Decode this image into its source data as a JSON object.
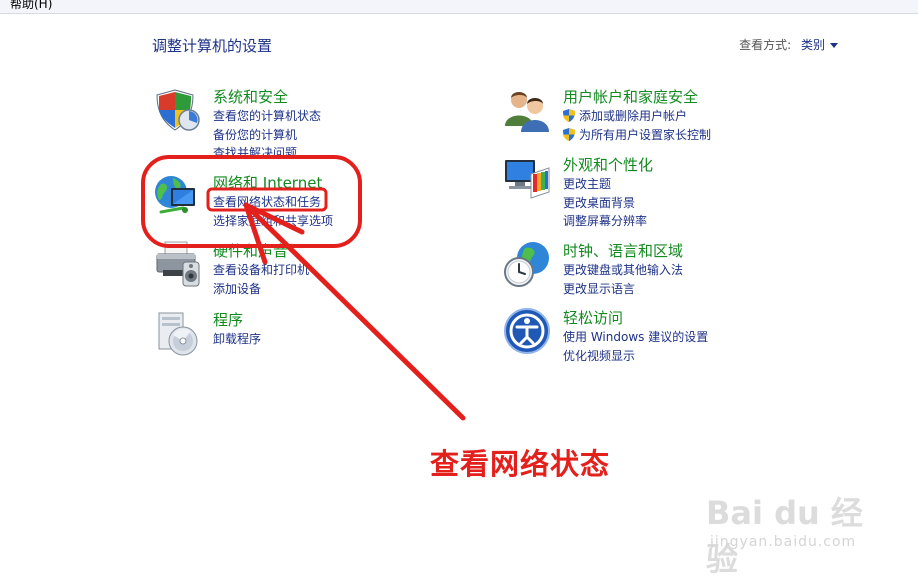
{
  "menubar": {
    "help": "帮助(H)"
  },
  "page_title": "调整计算机的设置",
  "view_by": {
    "label": "查看方式:",
    "value": "类别"
  },
  "categories": [
    {
      "title": "系统和安全",
      "icon": "shield-computer-icon",
      "links": [
        "查看您的计算机状态",
        "备份您的计算机",
        "查找并解决问题"
      ]
    },
    {
      "title": "网络和 Internet",
      "icon": "network-globe-icon",
      "links": [
        "查看网络状态和任务",
        "选择家庭组和共享选项"
      ]
    },
    {
      "title": "硬件和声音",
      "icon": "printer-icon",
      "links": [
        "查看设备和打印机",
        "添加设备"
      ]
    },
    {
      "title": "程序",
      "icon": "program-disc-icon",
      "links": [
        "卸载程序"
      ]
    },
    {
      "title": "用户帐户和家庭安全",
      "icon": "users-icon",
      "links": [
        "添加或删除用户帐户",
        "为所有用户设置家长控制"
      ]
    },
    {
      "title": "外观和个性化",
      "icon": "monitor-palette-icon",
      "links": [
        "更改主题",
        "更改桌面背景",
        "调整屏幕分辨率"
      ]
    },
    {
      "title": "时钟、语言和区域",
      "icon": "clock-globe-icon",
      "links": [
        "更改键盘或其他输入法",
        "更改显示语言"
      ]
    },
    {
      "title": "轻松访问",
      "icon": "ease-of-access-icon",
      "links": [
        "使用 Windows 建议的设置",
        "优化视频显示"
      ]
    }
  ],
  "annotation": {
    "text": "查看网络状态",
    "color": "#e4201c"
  },
  "watermark": {
    "main": "Bai du 经验",
    "sub": "jingyan.baidu.com"
  },
  "colors": {
    "link": "#1e3287",
    "category_title": "#138a1f",
    "annotation": "#e4201c"
  }
}
